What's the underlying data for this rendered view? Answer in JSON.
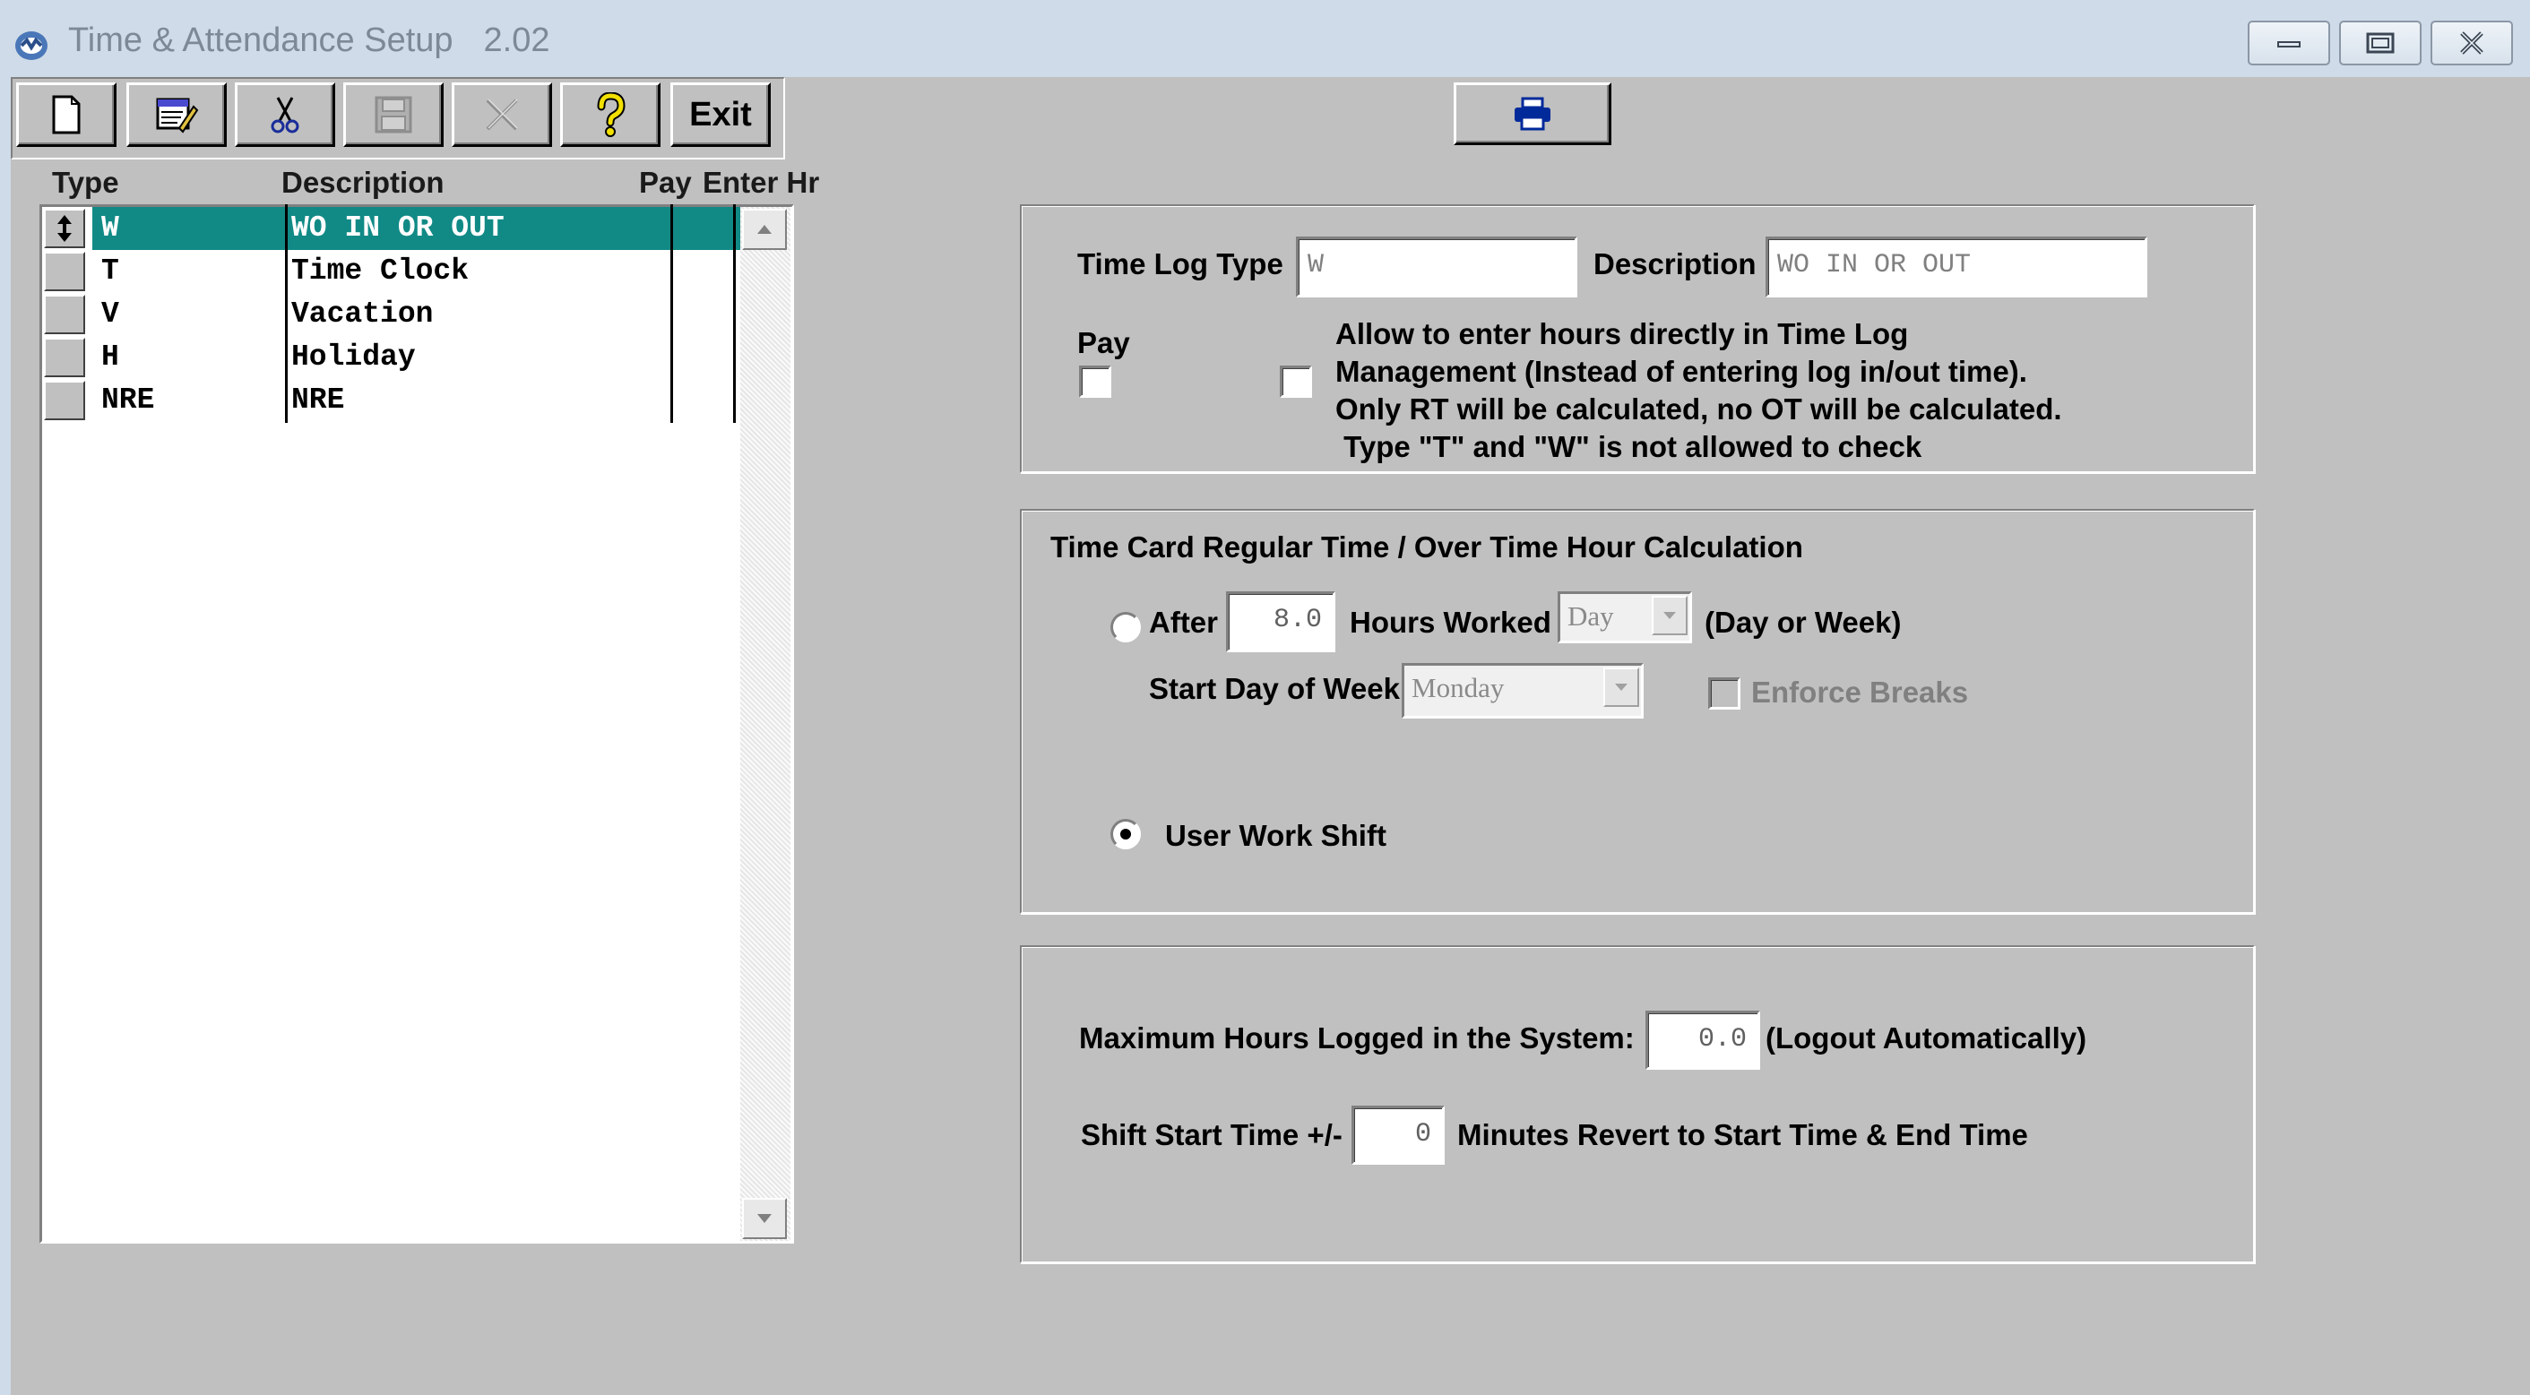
{
  "window": {
    "title": "Time & Attendance Setup",
    "version": "2.02",
    "controls": [
      "minimize-icon",
      "restore-icon",
      "close-icon"
    ]
  },
  "toolbar": {
    "buttons": [
      {
        "name": "new-button",
        "icon": "new-document-icon"
      },
      {
        "name": "edit-button",
        "icon": "edit-icon"
      },
      {
        "name": "cut-button",
        "icon": "scissors-icon"
      },
      {
        "name": "save-button",
        "icon": "floppy-disk-icon",
        "disabled": true
      },
      {
        "name": "delete-button",
        "icon": "x-delete-icon",
        "disabled": true
      },
      {
        "name": "help-button",
        "icon": "question-icon"
      }
    ],
    "exit_label": "Exit",
    "print_icon": "printer-icon"
  },
  "list": {
    "columns": {
      "type": "Type",
      "description": "Description",
      "pay": "Pay",
      "enter_hr": "Enter Hr"
    },
    "rows": [
      {
        "type": "W",
        "description": "WO IN OR OUT",
        "selected": true
      },
      {
        "type": "T",
        "description": "Time Clock"
      },
      {
        "type": "V",
        "description": "Vacation"
      },
      {
        "type": "H",
        "description": "Holiday"
      },
      {
        "type": "NRE",
        "description": "NRE"
      }
    ]
  },
  "time_log": {
    "type_label": "Time Log Type",
    "type_value": "W",
    "description_label": "Description",
    "description_value": "WO IN OR OUT",
    "pay_label": "Pay",
    "pay_checked": false,
    "allow_enter_checked": false,
    "allow_text": [
      "Allow to enter hours directly in Time Log",
      "Management (Instead of entering log in/out time).",
      "Only RT will be calculated, no OT will be calculated.",
      " Type \"T\" and \"W\" is not allowed to check"
    ]
  },
  "calculation": {
    "title": "Time Card Regular Time / Over Time Hour Calculation",
    "after_label": "After",
    "after_value": "8.0",
    "hours_worked_label": "Hours Worked",
    "period_value": "Day",
    "period_hint": "(Day or Week)",
    "start_day_label": "Start Day of Week",
    "start_day_value": "Monday",
    "enforce_breaks_label": "Enforce Breaks",
    "user_work_shift_label": "User Work Shift",
    "selected_option": "user_work_shift"
  },
  "limits": {
    "max_hours_label": "Maximum Hours Logged in the System:",
    "max_hours_value": "0.0",
    "max_hours_suffix": "(Logout Automatically)",
    "shift_start_label": "Shift Start Time +/-",
    "shift_start_value": "0",
    "shift_start_suffix": "Minutes Revert to Start Time & End Time"
  }
}
